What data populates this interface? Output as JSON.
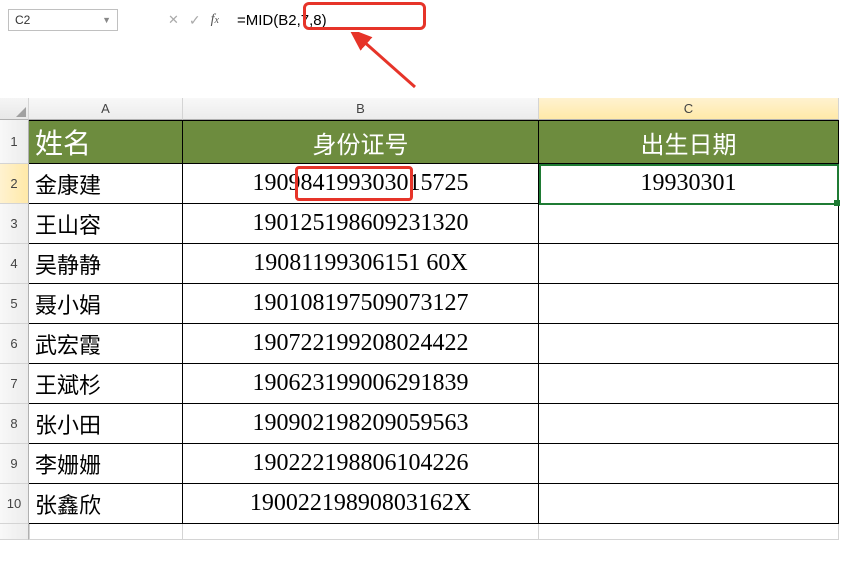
{
  "name_box": "C2",
  "formula": "=MID(B2,7,8)",
  "columns": {
    "A": "A",
    "B": "B",
    "C": "C"
  },
  "headers": {
    "A": "姓名",
    "B": "身份证号",
    "C": "出生日期"
  },
  "rows": [
    {
      "n": 2,
      "A": "金康建",
      "B": "190984199303015725",
      "C": "19930301"
    },
    {
      "n": 3,
      "A": "王山容",
      "B": "190125198609231320",
      "C": ""
    },
    {
      "n": 4,
      "A": "吴静静",
      "B": "19081199306151 60X",
      "C": ""
    },
    {
      "n": 5,
      "A": "聂小娟",
      "B": "190108197509073127",
      "C": ""
    },
    {
      "n": 6,
      "A": "武宏霞",
      "B": "190722199208024422",
      "C": ""
    },
    {
      "n": 7,
      "A": "王斌杉",
      "B": "190623199006291839",
      "C": ""
    },
    {
      "n": 8,
      "A": "张小田",
      "B": "190902198209059563",
      "C": ""
    },
    {
      "n": 9,
      "A": "李姗姗",
      "B": "190222198806104226",
      "C": ""
    },
    {
      "n": 10,
      "A": "张鑫欣",
      "B": "19002219890803162X",
      "C": ""
    }
  ],
  "id_highlight_substr": "19930301",
  "chart_data": {
    "type": "table",
    "title": "",
    "columns": [
      "姓名",
      "身份证号",
      "出生日期"
    ],
    "rows": [
      [
        "金康建",
        "190984199303015725",
        "19930301"
      ],
      [
        "王山容",
        "190125198609231320",
        ""
      ],
      [
        "吴静静",
        "19081199306151 60X",
        ""
      ],
      [
        "聂小娟",
        "190108197509073127",
        ""
      ],
      [
        "武宏霞",
        "190722199208024422",
        ""
      ],
      [
        "王斌杉",
        "190623199006291839",
        ""
      ],
      [
        "张小田",
        "190902198209059563",
        ""
      ],
      [
        "李姗姗",
        "190222198806104226",
        ""
      ],
      [
        "张鑫欣",
        "19002219890803162X",
        ""
      ]
    ]
  }
}
